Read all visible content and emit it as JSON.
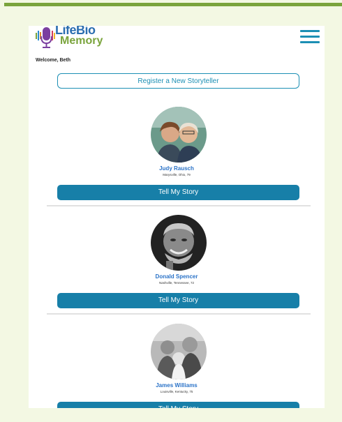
{
  "app": {
    "logo_line1": "LifeBio",
    "logo_line2": "Memory",
    "welcome": "Welcome, Beth",
    "register_label": "Register a New Storyteller"
  },
  "storytellers": [
    {
      "name": "Judy Rausch",
      "location": "Marysville, Ohio, 79",
      "button": "Tell My Story"
    },
    {
      "name": "Donald Spencer",
      "location": "Nashville, Tennessee, 72",
      "button": "Tell My Story"
    },
    {
      "name": "James Williams",
      "location": "Louisville, Kentucky, 75",
      "button": "Tell My Story"
    }
  ],
  "icons": {
    "logo": "microphone-icon",
    "menu": "hamburger-menu-icon"
  },
  "colors": {
    "accent": "#177fa8",
    "brand_green": "#7aa43c",
    "brand_blue": "#2a6db0",
    "name_blue": "#2b73c8",
    "page_bg": "#f3f8e3"
  }
}
